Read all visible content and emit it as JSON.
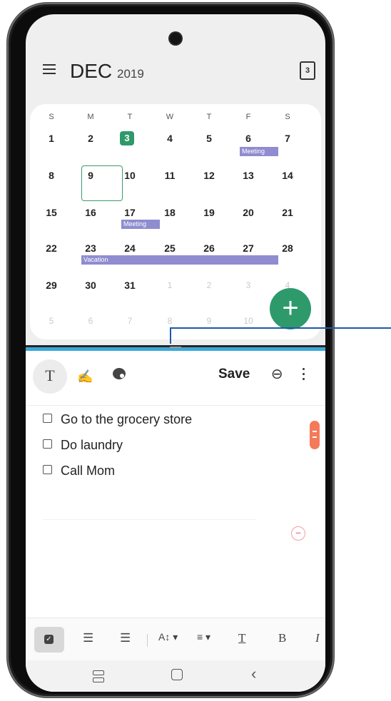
{
  "calendar": {
    "month": "DEC",
    "year": "2019",
    "today_icon_label": "3",
    "weekdays": [
      "S",
      "M",
      "T",
      "W",
      "T",
      "F",
      "S"
    ],
    "weeks": [
      [
        "1",
        "2",
        "3",
        "4",
        "5",
        "6",
        "7"
      ],
      [
        "8",
        "9",
        "10",
        "11",
        "12",
        "13",
        "14"
      ],
      [
        "15",
        "16",
        "17",
        "18",
        "19",
        "20",
        "21"
      ],
      [
        "22",
        "23",
        "24",
        "25",
        "26",
        "27",
        "28"
      ],
      [
        "29",
        "30",
        "31",
        "1",
        "2",
        "3",
        "4"
      ],
      [
        "5",
        "6",
        "7",
        "8",
        "9",
        "10",
        ""
      ]
    ],
    "today": "3",
    "selected": "9",
    "events": {
      "meeting_1": "Meeting",
      "meeting_2": "Meeting",
      "vacation": "Vacation"
    },
    "fab_icon": "plus-icon",
    "colors": {
      "accent": "#2e9a6c",
      "event": "#8f8cd0"
    }
  },
  "notes": {
    "tools": {
      "text_tool": "T",
      "pen_icon": "pen-icon",
      "palette_icon": "palette-icon"
    },
    "save_label": "Save",
    "items": [
      "Go to the grocery store",
      "Do laundry",
      "Call Mom"
    ],
    "format_bar": {
      "checkbox_icon": "checkbox-icon",
      "numbered_list_icon": "numbered-list-icon",
      "bullet_list_icon": "bullet-list-icon",
      "text_size_icon": "text-size-icon",
      "align_icon": "align-icon",
      "text_color_label": "T",
      "bold_label": "B",
      "italic_label": "I"
    }
  },
  "navbar": {
    "recents": "recents-icon",
    "home": "home-icon",
    "back": "back-icon"
  }
}
